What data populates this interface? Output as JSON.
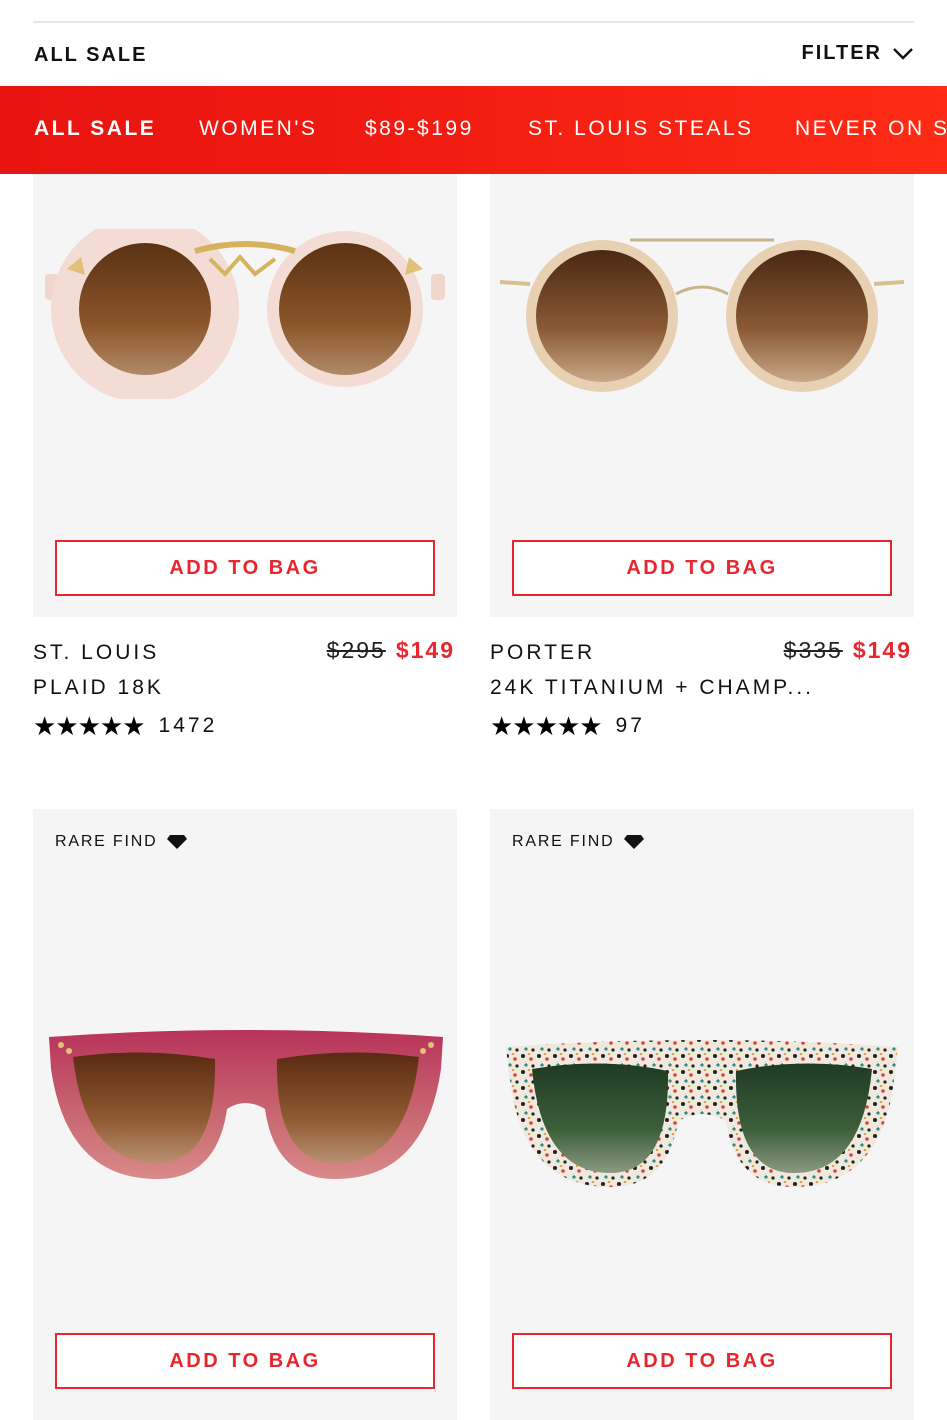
{
  "header": {
    "title": "ALL SALE",
    "filter_label": "FILTER"
  },
  "categories": [
    "ALL SALE",
    "WOMEN'S",
    "$89-$199",
    "ST. LOUIS STEALS",
    "NEVER ON S"
  ],
  "colors": {
    "accent_red": "#e8262e",
    "banner_red": "#f11a12",
    "card_bg": "#f5f5f5"
  },
  "products": [
    {
      "name": "ST. LOUIS",
      "variant": "PLAID 18K",
      "old_price": "$295",
      "price": "$149",
      "stars": "★★★★★",
      "reviews": "1472",
      "button": "ADD TO BAG"
    },
    {
      "name": "PORTER",
      "variant": "24K TITANIUM + CHAMP...",
      "old_price": "$335",
      "price": "$149",
      "stars": "★★★★★",
      "reviews": "97",
      "button": "ADD TO BAG"
    },
    {
      "badge": "RARE FIND",
      "button": "ADD TO BAG"
    },
    {
      "badge": "RARE FIND",
      "button": "ADD TO BAG"
    }
  ]
}
